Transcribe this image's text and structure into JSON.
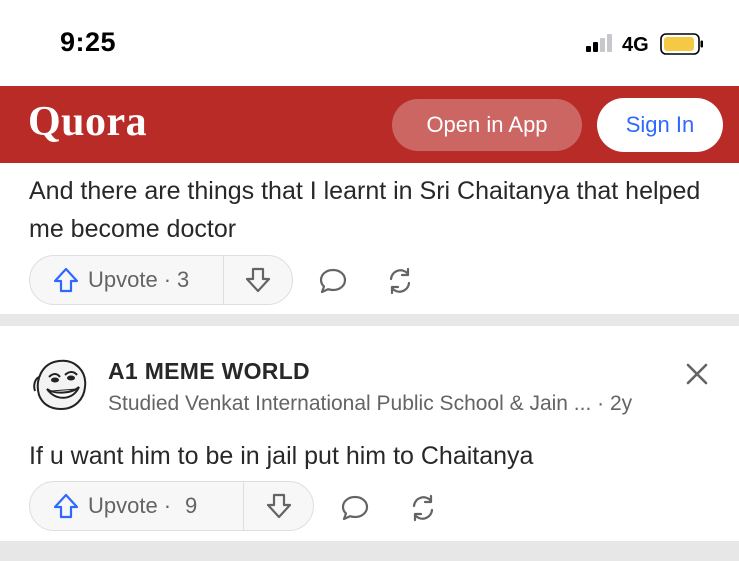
{
  "status_bar": {
    "time": "9:25",
    "network": "4G",
    "icons": [
      "signal-icon",
      "battery-icon"
    ]
  },
  "header": {
    "logo": "Quora",
    "open_in_app": "Open in App",
    "sign_in": "Sign In",
    "colors": {
      "brand": "#b92b27",
      "signin_text": "#2e69ff"
    }
  },
  "answers": [
    {
      "text": "And there are things that I learnt in Sri Chaitanya that helped me become doctor",
      "upvote_label": "Upvote",
      "upvote_sep": "·",
      "upvote_count": "3"
    },
    {
      "author": "A1 MEME WORLD",
      "credential": "Studied Venkat International Public School & Jain ... · 2y",
      "text": "If u want him to be in jail put him to Chaitanya",
      "upvote_label": "Upvote",
      "upvote_sep": "·",
      "upvote_count": "9"
    }
  ]
}
